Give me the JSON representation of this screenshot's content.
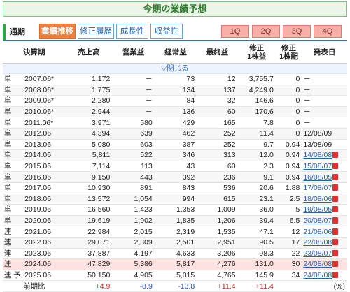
{
  "title": "今期の業績予想",
  "period_label": "通期",
  "tabs": [
    {
      "label": "業績推移",
      "active": true
    },
    {
      "label": "修正履歴",
      "active": false
    },
    {
      "label": "成長性",
      "active": false
    },
    {
      "label": "収益性",
      "active": false
    }
  ],
  "quarter_tabs": [
    "1Q",
    "2Q",
    "3Q",
    "4Q"
  ],
  "columns": {
    "fy": "決算期",
    "sales": "売上高",
    "op": "営業益",
    "ord": "経常益",
    "net": "最終益",
    "eps": "修正\n1株益",
    "div": "修正\n1株配",
    "date": "発表日"
  },
  "toggle_label": "▽閉じる",
  "rows": [
    {
      "kind": "単",
      "fy": "2007.06*",
      "sales": "1,172",
      "op": "－",
      "ord": "73",
      "net": "12",
      "eps": "3,755.7",
      "div": "0",
      "date": "－",
      "link": false,
      "pdf": false
    },
    {
      "kind": "単",
      "fy": "2008.06*",
      "sales": "1,775",
      "op": "－",
      "ord": "134",
      "net": "137",
      "eps": "4,249.0",
      "div": "0",
      "date": "－",
      "link": false,
      "pdf": false
    },
    {
      "kind": "単",
      "fy": "2009.06*",
      "sales": "2,280",
      "op": "－",
      "ord": "84",
      "net": "32",
      "eps": "146.6",
      "div": "0",
      "date": "－",
      "link": false,
      "pdf": false
    },
    {
      "kind": "単",
      "fy": "2010.06*",
      "sales": "2,944",
      "op": "－",
      "ord": "136",
      "net": "60",
      "eps": "170.6",
      "div": "0",
      "date": "－",
      "link": false,
      "pdf": false
    },
    {
      "kind": "単",
      "fy": "2011.06*",
      "sales": "3,971",
      "op": "580",
      "ord": "429",
      "net": "165",
      "eps": "7.8",
      "div": "0",
      "date": "－",
      "link": false,
      "pdf": false
    },
    {
      "kind": "単",
      "fy": "2012.06",
      "sales": "4,394",
      "op": "639",
      "ord": "462",
      "net": "252",
      "eps": "11.4",
      "div": "0",
      "date": "12/08/09",
      "link": false,
      "pdf": false
    },
    {
      "kind": "単",
      "fy": "2013.06",
      "sales": "5,080",
      "op": "603",
      "ord": "387",
      "net": "252",
      "eps": "9.7",
      "div": "0.94",
      "date": "13/08/09",
      "link": false,
      "pdf": false
    },
    {
      "kind": "単",
      "fy": "2014.06",
      "sales": "5,811",
      "op": "522",
      "ord": "346",
      "net": "313",
      "eps": "12.0",
      "div": "0.94",
      "date": "14/08/08",
      "link": true,
      "pdf": true
    },
    {
      "kind": "単",
      "fy": "2015.06",
      "sales": "7,114",
      "op": "113",
      "ord": "43",
      "net": "60",
      "eps": "2.3",
      "div": "0.94",
      "date": "15/08/07",
      "link": true,
      "pdf": true
    },
    {
      "kind": "単",
      "fy": "2016.06",
      "sales": "9,150",
      "op": "443",
      "ord": "392",
      "net": "236",
      "eps": "9.1",
      "div": "0.94",
      "date": "16/08/05",
      "link": true,
      "pdf": true
    },
    {
      "kind": "単",
      "fy": "2017.06",
      "sales": "10,930",
      "op": "891",
      "ord": "843",
      "net": "536",
      "eps": "20.6",
      "div": "1.88",
      "date": "17/08/07",
      "link": true,
      "pdf": true
    },
    {
      "kind": "単",
      "fy": "2018.06",
      "sales": "13,572",
      "op": "1,054",
      "ord": "994",
      "net": "615",
      "eps": "23.1",
      "div": "2.5",
      "date": "18/08/06",
      "link": true,
      "pdf": true
    },
    {
      "kind": "単",
      "fy": "2019.06",
      "sales": "16,560",
      "op": "1,423",
      "ord": "1,353",
      "net": "1,009",
      "eps": "36.0",
      "div": "5",
      "date": "19/08/05",
      "link": true,
      "pdf": true
    },
    {
      "kind": "単",
      "fy": "2020.06",
      "sales": "19,619",
      "op": "1,902",
      "ord": "1,835",
      "net": "1,206",
      "eps": "39.4",
      "div": "6.5",
      "date": "20/08/07",
      "link": true,
      "pdf": true
    },
    {
      "kind": "連",
      "fy": "2021.06",
      "sales": "22,984",
      "op": "2,015",
      "ord": "2,319",
      "net": "1,535",
      "eps": "47.1",
      "div": "12",
      "date": "21/08/06",
      "link": true,
      "pdf": true
    },
    {
      "kind": "連",
      "fy": "2022.06",
      "sales": "29,071",
      "op": "2,309",
      "ord": "2,501",
      "net": "2,951",
      "eps": "90.5",
      "div": "17",
      "date": "22/08/08",
      "link": true,
      "pdf": true
    },
    {
      "kind": "連",
      "fy": "2023.06",
      "sales": "37,887",
      "op": "4,197",
      "ord": "4,633",
      "net": "3,206",
      "eps": "98.3",
      "div": "22",
      "date": "23/08/07",
      "link": true,
      "pdf": true
    },
    {
      "kind": "連",
      "fy": "2024.06",
      "sales": "47,829",
      "op": "5,386",
      "ord": "5,817",
      "net": "4,276",
      "eps": "131.0",
      "div": "30",
      "date": "24/08/08",
      "link": true,
      "pdf": true,
      "highlight": true
    },
    {
      "kind": "連 予",
      "fy": "2025.06",
      "sales": "50,150",
      "op": "4,905",
      "ord": "5,015",
      "net": "4,765",
      "eps": "145.9",
      "div": "34",
      "date": "24/08/08",
      "link": true,
      "pdf": true
    }
  ],
  "yoy": {
    "label": "前期比",
    "sales": "+4.9",
    "op": "-8.9",
    "ord": "-13.8",
    "net": "+11.4",
    "eps": "+11.4",
    "unit": "(%)"
  },
  "colors": {
    "accent_tab": "#f07f3a",
    "header_rule": "#2f6ec6",
    "highlight_row": "#fde2e0",
    "positive": "#d42020",
    "negative": "#2050c0"
  }
}
